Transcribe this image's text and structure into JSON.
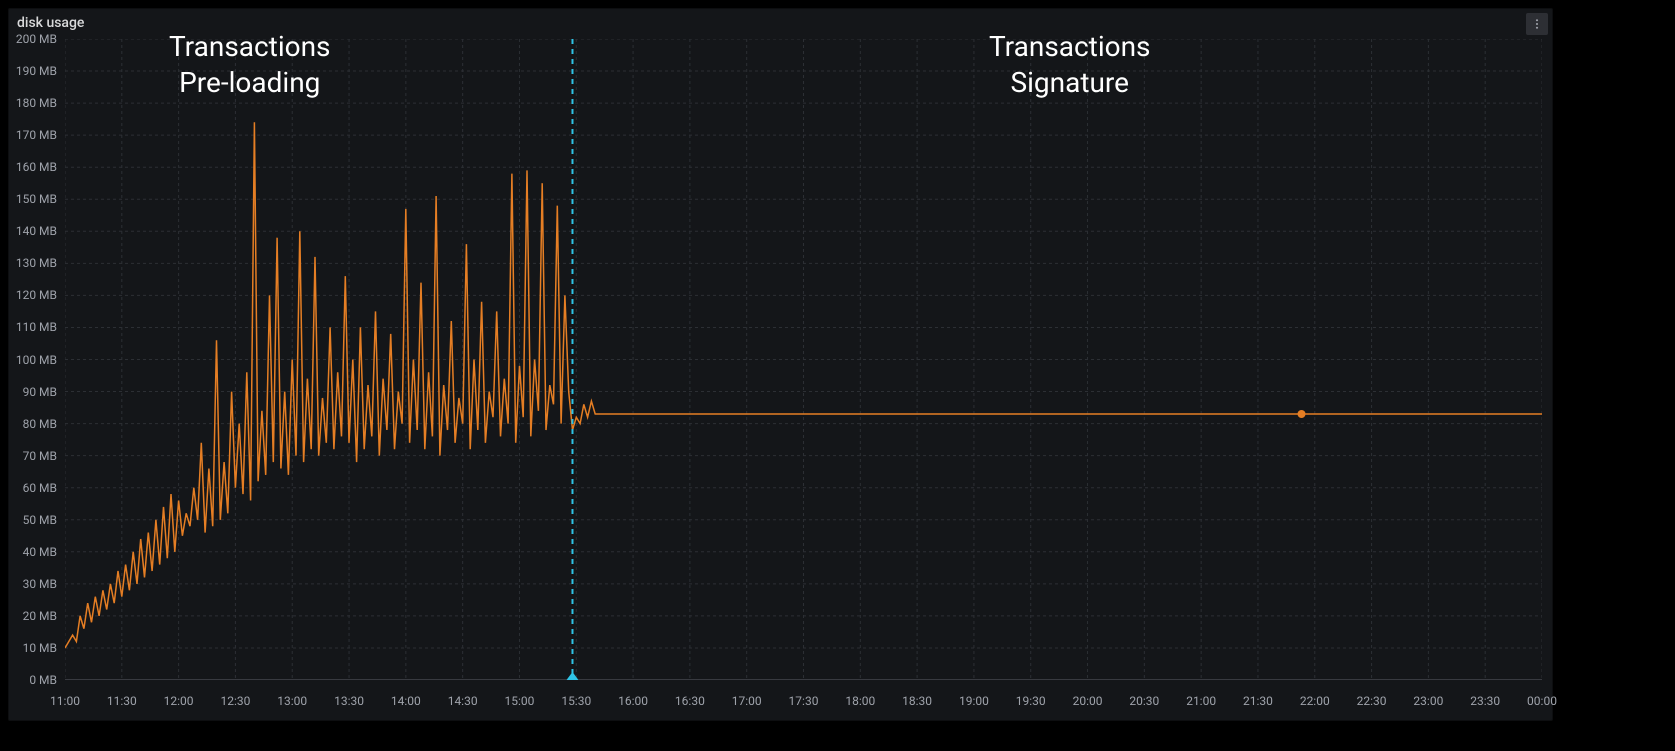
{
  "panel": {
    "title": "disk usage"
  },
  "annotations": {
    "left": {
      "line1": "Transactions",
      "line2": "Pre-loading"
    },
    "right": {
      "line1": "Transactions",
      "line2": "Signature"
    }
  },
  "chart_data": {
    "type": "line",
    "title": "disk usage",
    "xlabel": "",
    "ylabel": "",
    "y_unit": "MB",
    "ylim": [
      0,
      200
    ],
    "y_ticks": [
      "0 MB",
      "10 MB",
      "20 MB",
      "30 MB",
      "40 MB",
      "50 MB",
      "60 MB",
      "70 MB",
      "80 MB",
      "90 MB",
      "100 MB",
      "110 MB",
      "120 MB",
      "130 MB",
      "140 MB",
      "150 MB",
      "160 MB",
      "170 MB",
      "180 MB",
      "190 MB",
      "200 MB"
    ],
    "x_ticks": [
      "11:00",
      "11:30",
      "12:00",
      "12:30",
      "13:00",
      "13:30",
      "14:00",
      "14:30",
      "15:00",
      "15:30",
      "16:00",
      "16:30",
      "17:00",
      "17:30",
      "18:00",
      "18:30",
      "19:00",
      "19:30",
      "20:00",
      "20:30",
      "21:00",
      "21:30",
      "22:00",
      "22:30",
      "23:00",
      "23:30",
      "00:00"
    ],
    "x_range_minutes": [
      0,
      780
    ],
    "divider_at_minutes": 268,
    "marker_at": {
      "minutes": 653,
      "value": 83
    },
    "series": [
      {
        "name": "disk usage",
        "color": "#e57e24",
        "x_minutes": [
          0,
          4,
          6,
          8,
          10,
          12,
          14,
          16,
          18,
          20,
          22,
          24,
          26,
          28,
          30,
          32,
          34,
          36,
          38,
          40,
          42,
          44,
          46,
          48,
          50,
          52,
          54,
          56,
          58,
          60,
          62,
          64,
          66,
          68,
          70,
          72,
          74,
          76,
          78,
          80,
          82,
          84,
          86,
          88,
          90,
          92,
          94,
          96,
          98,
          100,
          102,
          104,
          106,
          108,
          110,
          112,
          114,
          116,
          118,
          120,
          122,
          124,
          126,
          128,
          130,
          132,
          134,
          136,
          138,
          140,
          142,
          144,
          146,
          148,
          150,
          152,
          154,
          156,
          158,
          160,
          162,
          164,
          166,
          168,
          170,
          172,
          174,
          176,
          178,
          180,
          182,
          184,
          186,
          188,
          190,
          192,
          194,
          196,
          198,
          200,
          202,
          204,
          206,
          208,
          210,
          212,
          214,
          216,
          218,
          220,
          222,
          224,
          226,
          228,
          230,
          232,
          234,
          236,
          238,
          240,
          242,
          244,
          246,
          248,
          250,
          252,
          254,
          256,
          258,
          260,
          262,
          264,
          266,
          268,
          270,
          272,
          274,
          276,
          278,
          280,
          290,
          300,
          320,
          340,
          360,
          380,
          400,
          420,
          440,
          460,
          480,
          500,
          520,
          540,
          560,
          580,
          600,
          620,
          640,
          660,
          680,
          700,
          720,
          740,
          760,
          780
        ],
        "values": [
          10,
          14,
          12,
          20,
          16,
          24,
          18,
          26,
          20,
          28,
          22,
          30,
          24,
          34,
          26,
          36,
          28,
          40,
          30,
          44,
          32,
          46,
          34,
          50,
          36,
          54,
          38,
          58,
          40,
          56,
          45,
          52,
          48,
          60,
          50,
          74,
          46,
          66,
          48,
          106,
          50,
          68,
          52,
          90,
          60,
          80,
          58,
          96,
          56,
          174,
          62,
          84,
          64,
          120,
          68,
          138,
          66,
          90,
          64,
          100,
          70,
          140,
          68,
          94,
          72,
          132,
          70,
          88,
          74,
          110,
          72,
          96,
          76,
          126,
          74,
          100,
          68,
          110,
          72,
          92,
          76,
          115,
          70,
          94,
          78,
          108,
          72,
          90,
          80,
          147,
          74,
          100,
          78,
          124,
          72,
          96,
          76,
          151,
          70,
          92,
          78,
          112,
          74,
          88,
          80,
          136,
          72,
          100,
          78,
          118,
          74,
          90,
          82,
          115,
          76,
          94,
          80,
          158,
          74,
          98,
          82,
          159,
          76,
          100,
          84,
          155,
          78,
          92,
          86,
          148,
          80,
          120,
          90,
          78,
          82,
          80,
          86,
          82,
          87,
          83,
          83,
          83,
          83,
          83,
          83,
          83,
          83,
          83,
          83,
          83,
          83,
          83,
          83,
          83,
          83,
          83,
          83,
          83,
          83,
          83,
          83,
          83,
          83,
          83,
          83,
          83
        ]
      }
    ],
    "regions": [
      {
        "label": "Transactions Pre-loading",
        "x_minutes": [
          0,
          268
        ]
      },
      {
        "label": "Transactions Signature",
        "x_minutes": [
          268,
          780
        ]
      }
    ]
  }
}
